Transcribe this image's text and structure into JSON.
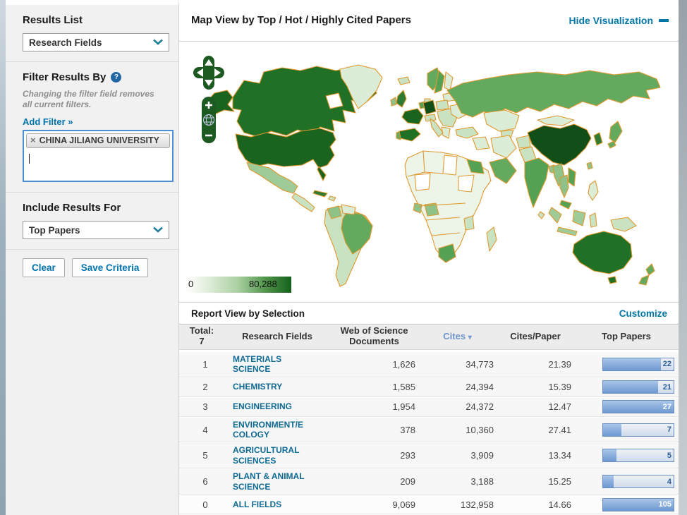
{
  "sidebar": {
    "results_list": {
      "label": "Results List",
      "selected": "Research Fields"
    },
    "filter": {
      "title": "Filter Results By",
      "help_icon": "?",
      "note": "Changing the filter field removes all current filters.",
      "add_filter_label": "Add Filter »",
      "tag": {
        "remove_icon": "×",
        "label": "CHINA JILIANG UNIVERSITY"
      }
    },
    "include_results": {
      "label": "Include Results For",
      "selected": "Top Papers"
    },
    "buttons": {
      "clear": "Clear",
      "save": "Save Criteria"
    }
  },
  "map_panel": {
    "title": "Map View by Top / Hot / Highly Cited Papers",
    "hide_link": "Hide Visualization",
    "legend": {
      "min": "0",
      "max": "80,288"
    },
    "controls": {
      "zoom_in": "+",
      "zoom_out": "−"
    }
  },
  "report": {
    "title": "Report View by Selection",
    "customize_link": "Customize",
    "table": {
      "total_label": "Total:\n7",
      "columns": {
        "field": "Research Fields",
        "docs": "Web of Science\nDocuments",
        "cites": "Cites",
        "sort_arrow": "▾",
        "cites_per_paper": "Cites/Paper",
        "top_papers": "Top Papers"
      },
      "rows": [
        {
          "rank": "1",
          "field": "MATERIALS\nSCIENCE",
          "docs": "1,626",
          "cites": "34,773",
          "cpp": "21.39",
          "top": "22",
          "bar_pct": 81.5,
          "bar_full": false
        },
        {
          "rank": "2",
          "field": "CHEMISTRY",
          "docs": "1,585",
          "cites": "24,394",
          "cpp": "15.39",
          "top": "21",
          "bar_pct": 77.8,
          "bar_full": false
        },
        {
          "rank": "3",
          "field": "ENGINEERING",
          "docs": "1,954",
          "cites": "24,372",
          "cpp": "12.47",
          "top": "27",
          "bar_pct": 100,
          "bar_full": true
        },
        {
          "rank": "4",
          "field": "ENVIRONMENT/E\nCOLOGY",
          "docs": "378",
          "cites": "10,360",
          "cpp": "27.41",
          "top": "7",
          "bar_pct": 25.9,
          "bar_full": false
        },
        {
          "rank": "5",
          "field": "AGRICULTURAL\nSCIENCES",
          "docs": "293",
          "cites": "3,909",
          "cpp": "13.34",
          "top": "5",
          "bar_pct": 18.5,
          "bar_full": false
        },
        {
          "rank": "6",
          "field": "PLANT & ANIMAL\nSCIENCE",
          "docs": "209",
          "cites": "3,188",
          "cpp": "15.25",
          "top": "4",
          "bar_pct": 14.8,
          "bar_full": false
        },
        {
          "rank": "0",
          "field": "ALL FIELDS",
          "docs": "9,069",
          "cites": "132,958",
          "cpp": "14.66",
          "top": "105",
          "bar_pct": 100,
          "bar_full": true
        }
      ]
    }
  },
  "colors": {
    "link_blue": "#0077a9",
    "field_link": "#0e6a93",
    "bar_fill": "#8db0dd",
    "bar_border": "#6a8ebf",
    "map_border_orange": "#e0982e",
    "map_dark_green": "#1a6420",
    "map_light_green": "#dcedd7",
    "control_green": "#1d5a21"
  }
}
